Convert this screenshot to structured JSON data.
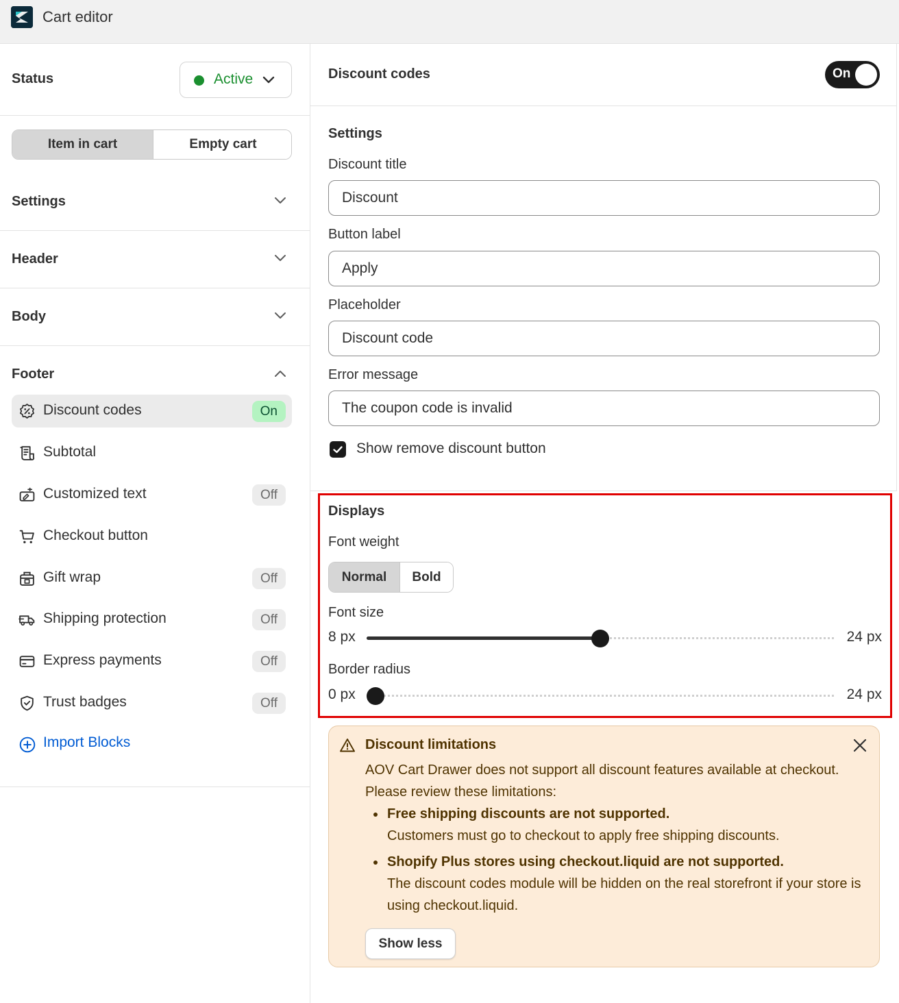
{
  "app": {
    "title": "Cart editor"
  },
  "status": {
    "label": "Status",
    "value": "Active",
    "color": "#1a8f2f"
  },
  "cart_tabs": {
    "item_in_cart": "Item in cart",
    "empty_cart": "Empty cart",
    "selected": "Item in cart"
  },
  "sections": {
    "settings": "Settings",
    "header": "Header",
    "body": "Body",
    "footer": "Footer"
  },
  "footer_blocks": [
    {
      "label": "Discount codes",
      "icon": "discount-icon",
      "status": "On",
      "selected": true
    },
    {
      "label": "Subtotal",
      "icon": "receipt-icon",
      "status": ""
    },
    {
      "label": "Customized text",
      "icon": "custom-text-icon",
      "status": "Off"
    },
    {
      "label": "Checkout button",
      "icon": "cart-icon",
      "status": ""
    },
    {
      "label": "Gift wrap",
      "icon": "gift-icon",
      "status": "Off"
    },
    {
      "label": "Shipping protection",
      "icon": "truck-icon",
      "status": "Off"
    },
    {
      "label": "Express payments",
      "icon": "credit-card-icon",
      "status": "Off"
    },
    {
      "label": "Trust badges",
      "icon": "shield-icon",
      "status": "Off"
    }
  ],
  "import_blocks": {
    "label": "Import Blocks",
    "color": "#005bd3"
  },
  "discount_codes": {
    "title": "Discount codes",
    "toggle_label": "On",
    "settings": {
      "title": "Settings",
      "discount_title_label": "Discount title",
      "discount_title_value": "Discount",
      "button_label_label": "Button label",
      "button_label_value": "Apply",
      "placeholder_label": "Placeholder",
      "placeholder_value": "Discount code",
      "error_message_label": "Error message",
      "error_message_value": "The coupon code is invalid",
      "show_remove_label": "Show remove discount button",
      "show_remove_checked": true
    },
    "displays": {
      "title": "Displays",
      "font_weight_label": "Font weight",
      "font_weight_options": [
        "Normal",
        "Bold"
      ],
      "font_weight_selected": "Normal",
      "font_size_label": "Font size",
      "font_size": {
        "min_label": "8 px",
        "max_label": "24 px",
        "min": 8,
        "max": 24,
        "value": 16
      },
      "border_radius_label": "Border radius",
      "border_radius": {
        "min_label": "0 px",
        "max_label": "24 px",
        "min": 0,
        "max": 24,
        "value": 0
      }
    }
  },
  "limitations": {
    "title": "Discount limitations",
    "body": "AOV Cart Drawer does not support all discount features available at checkout. Please review these limitations:",
    "items": [
      {
        "head": "Free shipping discounts are not supported.",
        "text": "Customers must go to checkout to apply free shipping discounts."
      },
      {
        "head": "Shopify Plus stores using checkout.liquid are not supported.",
        "text": "The discount codes module will be hidden on the real storefront if your store is using checkout.liquid."
      }
    ],
    "show_less_label": "Show less"
  }
}
